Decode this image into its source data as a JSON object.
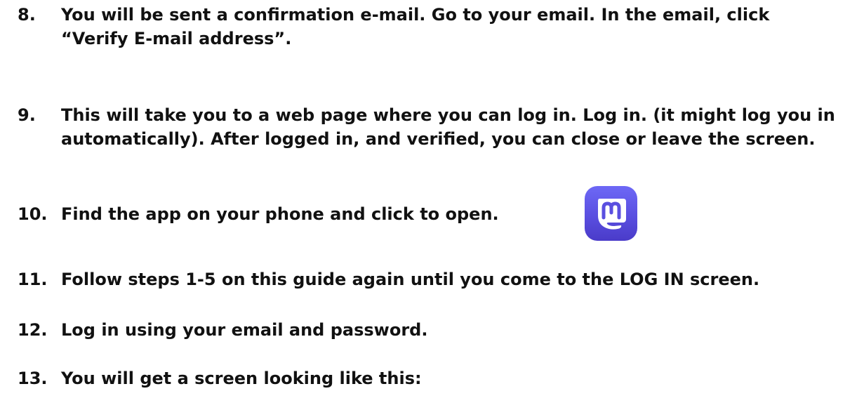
{
  "steps": [
    {
      "number": "8.",
      "text": "You will be sent a confirmation e-mail. Go to your email. In the email, click “Verify E-mail address”."
    },
    {
      "number": "9.",
      "text": "This will take you to a web page where you can log in. Log in. (it might log you in automatically). After logged in, and verified, you can close or leave the screen."
    },
    {
      "number": "10.",
      "text": "Find the app on your phone and click to open."
    },
    {
      "number": "11.",
      "text": "Follow steps 1-5 on this guide again until you come to the LOG IN screen."
    },
    {
      "number": "12.",
      "text": "Log in using your email and password."
    },
    {
      "number": "13.",
      "text": "You will get a screen looking like this:"
    }
  ],
  "app_icon": {
    "icon": "mastodon-icon",
    "color": "#5b50e6"
  }
}
